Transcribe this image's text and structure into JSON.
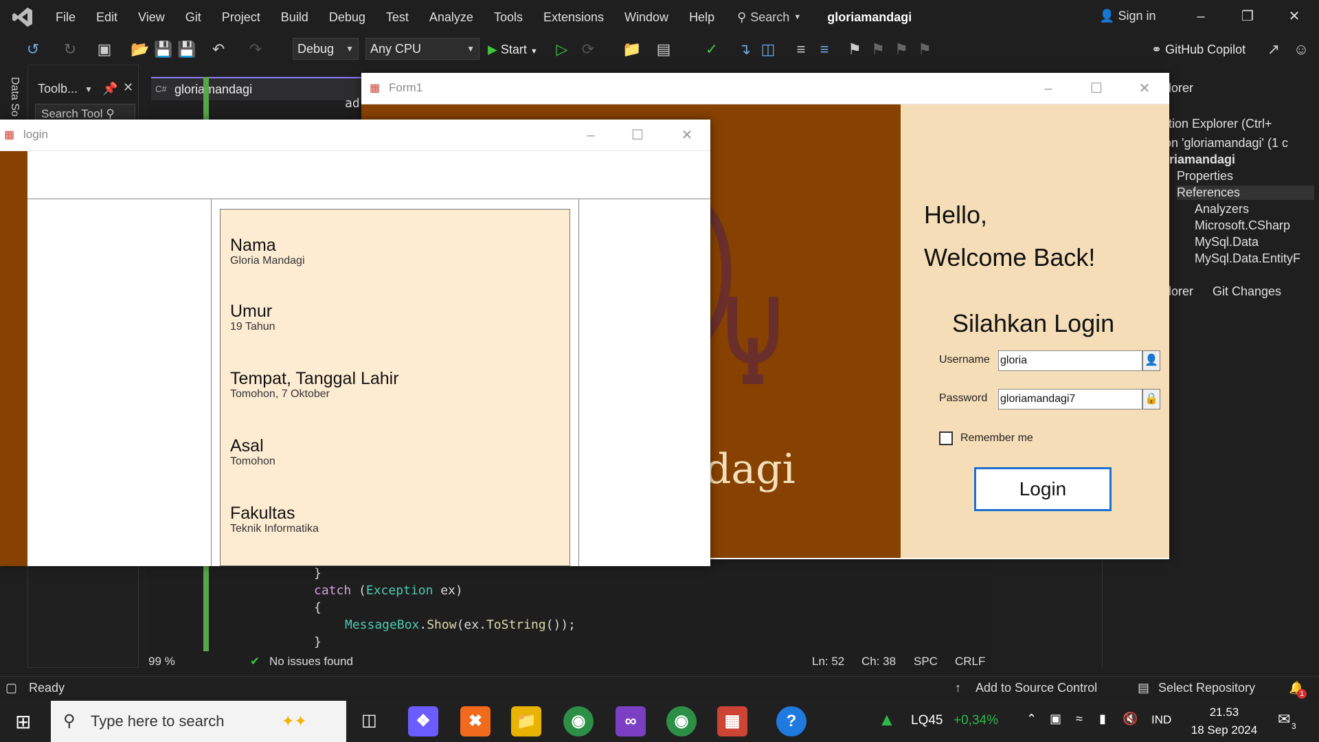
{
  "menubar": {
    "items": [
      "File",
      "Edit",
      "View",
      "Git",
      "Project",
      "Build",
      "Debug",
      "Test",
      "Analyze",
      "Tools",
      "Extensions",
      "Window",
      "Help"
    ],
    "search": "Search",
    "solution_title": "gloriamandagi",
    "sign_in": "Sign in"
  },
  "toolbar": {
    "config": "Debug",
    "platform": "Any CPU",
    "start": "Start",
    "copilot": "GitHub Copilot"
  },
  "side": {
    "data_sources": "Data So"
  },
  "toolbox": {
    "title": "Toolb...",
    "search": "Search Tool"
  },
  "editor": {
    "tab": "gloriamandagi",
    "peek": "ad",
    "lines": [
      {
        "text": "}"
      },
      {
        "kw": "catch",
        "rest_open": " (",
        "type": "Exception",
        "rest_close": " ex)"
      },
      {
        "text": "{"
      },
      {
        "type": "MessageBox",
        "dot": ".",
        "fn": "Show",
        "rest": "(ex.",
        "fn2": "ToString",
        "end": "());"
      },
      {
        "text": "}"
      }
    ],
    "status": {
      "zoom": "99 %",
      "issues": "No issues found",
      "ln": "Ln: 52",
      "ch": "Ch: 38",
      "spc": "SPC",
      "crlf": "CRLF"
    }
  },
  "solution_explorer": {
    "title": "plorer",
    "search": "ution Explorer (Ctrl+",
    "items": [
      "ion 'gloriamandagi' (1 c",
      "oriamandagi",
      "Properties",
      "References",
      "Analyzers",
      "Microsoft.CSharp",
      "MySql.Data",
      "MySql.Data.EntityF"
    ],
    "tabs": [
      "plorer",
      "Git Changes"
    ]
  },
  "statusbar": {
    "ready": "Ready",
    "source_control": "Add to Source Control",
    "repo": "Select Repository",
    "notif": "1"
  },
  "taskbar": {
    "search": "Type here to search",
    "ticker": "LQ45",
    "ticker_change": "+0,34%",
    "lang": "IND",
    "time": "21.53",
    "date": "18 Sep 2024",
    "notifications": "3"
  },
  "form1": {
    "title": "Form1",
    "brand": "dagi",
    "hello": "Hello,",
    "welcome": "Welcome Back!",
    "heading": "Silahkan Login",
    "username_label": "Username",
    "username_value": "gloria",
    "password_label": "Password",
    "password_value": "gloriamandagi7",
    "remember": "Remember me",
    "login_button": "Login"
  },
  "login_window": {
    "title": "login",
    "fields": [
      {
        "label": "Nama",
        "value": "Gloria Mandagi"
      },
      {
        "label": "Umur",
        "value": "19 Tahun"
      },
      {
        "label": "Tempat, Tanggal Lahir",
        "value": "Tomohon, 7 Oktober"
      },
      {
        "label": "Asal",
        "value": "Tomohon"
      },
      {
        "label": "Fakultas",
        "value": "Teknik Informatika"
      }
    ]
  }
}
